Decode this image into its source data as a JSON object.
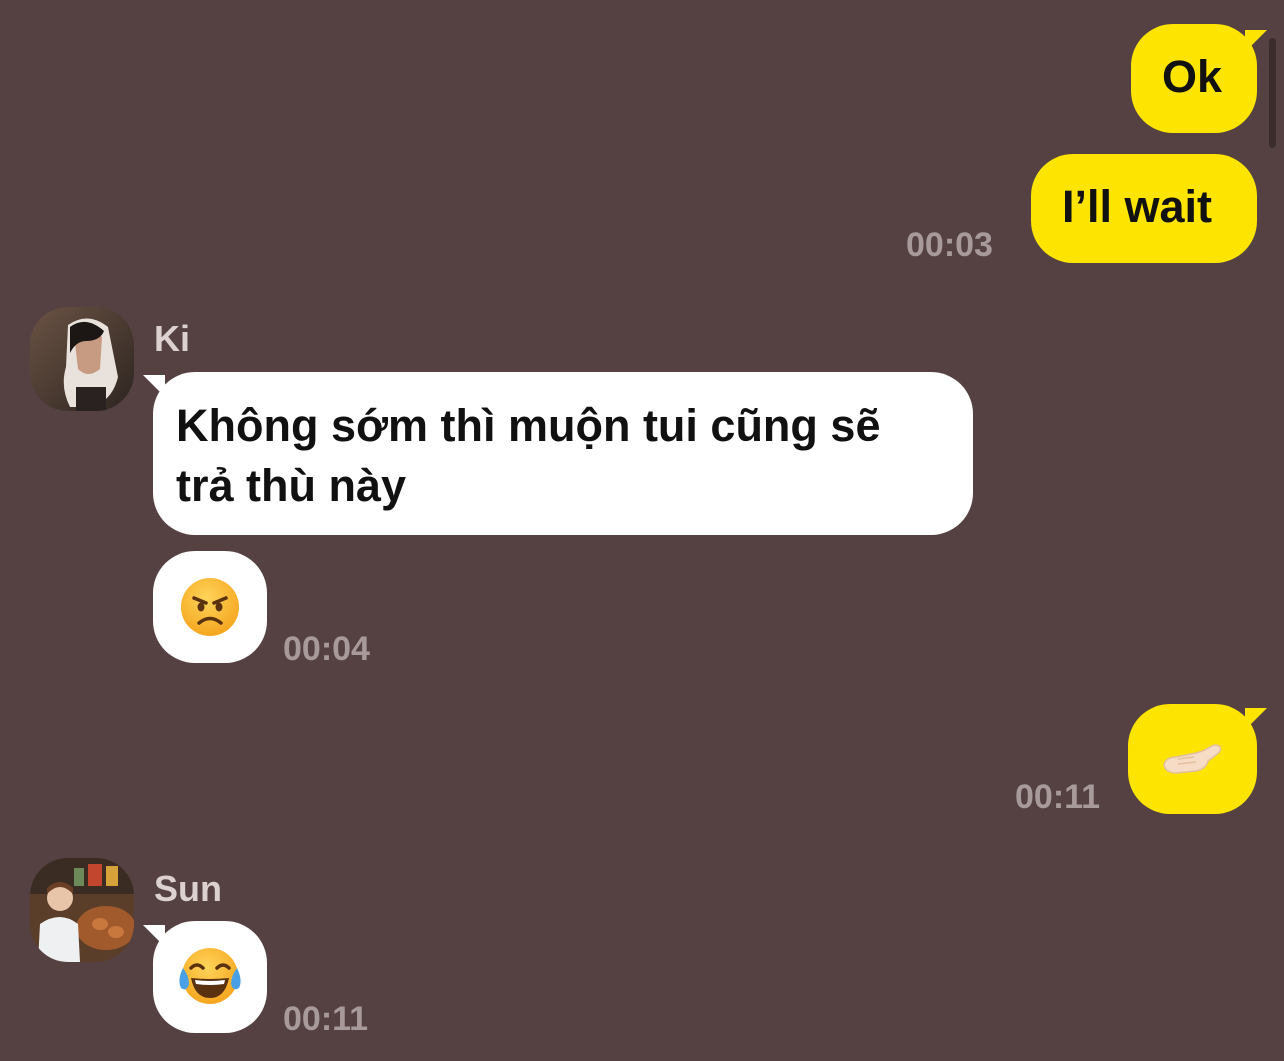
{
  "messages": {
    "ok_text": "Ok",
    "wait_text": "I’ll wait",
    "time_1": "00:03",
    "ki_name": "Ki",
    "ki_text_line1": "Không sớm thì muộn tui cũng sẽ",
    "ki_text_line2": "trả thù này",
    "angry_emoji": "angry-face-emoji",
    "time_2": "00:04",
    "hand_emoji": "palm-up-hand-emoji",
    "time_3": "00:11",
    "sun_name": "Sun",
    "laugh_emoji": "face-with-tears-of-joy-emoji",
    "time_4": "00:11"
  },
  "colors": {
    "background": "#554142",
    "my_bubble": "#fde501",
    "their_bubble": "#ffffff",
    "timestamp": "#a8999a",
    "sender_name": "#ddd0d0"
  }
}
